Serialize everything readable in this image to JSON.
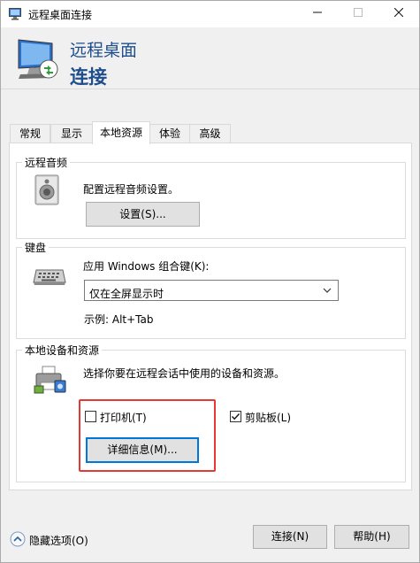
{
  "window": {
    "title": "远程桌面连接"
  },
  "banner": {
    "line1": "远程桌面",
    "line2": "连接"
  },
  "tabs": [
    {
      "label": "常规"
    },
    {
      "label": "显示"
    },
    {
      "label": "本地资源"
    },
    {
      "label": "体验"
    },
    {
      "label": "高级"
    }
  ],
  "active_tab": "本地资源",
  "audio": {
    "group_title": "远程音频",
    "description": "配置远程音频设置。",
    "settings_button": "设置(S)..."
  },
  "keyboard": {
    "group_title": "键盘",
    "label": "应用 Windows 组合键(K):",
    "selected_option": "仅在全屏显示时",
    "example": "示例: Alt+Tab"
  },
  "devices": {
    "group_title": "本地设备和资源",
    "description": "选择你要在远程会话中使用的设备和资源。",
    "printer_label": "打印机(T)",
    "printer_checked": false,
    "clipboard_label": "剪贴板(L)",
    "clipboard_checked": true,
    "details_button": "详细信息(M)..."
  },
  "footer": {
    "hide_options": "隐藏选项(O)",
    "connect_button": "连接(N)",
    "help_button": "帮助(H)"
  },
  "icons": {
    "app": "remote-desktop-icon",
    "monitor": "monitor-icon",
    "speaker": "speaker-icon",
    "keyboard": "keyboard-icon",
    "devices": "printer-devices-icon",
    "collapse": "chevron-up-circle-icon"
  },
  "colors": {
    "banner_text": "#1e4e8c",
    "default_button_border": "#0078d7",
    "annotation_highlight": "#e53935"
  }
}
